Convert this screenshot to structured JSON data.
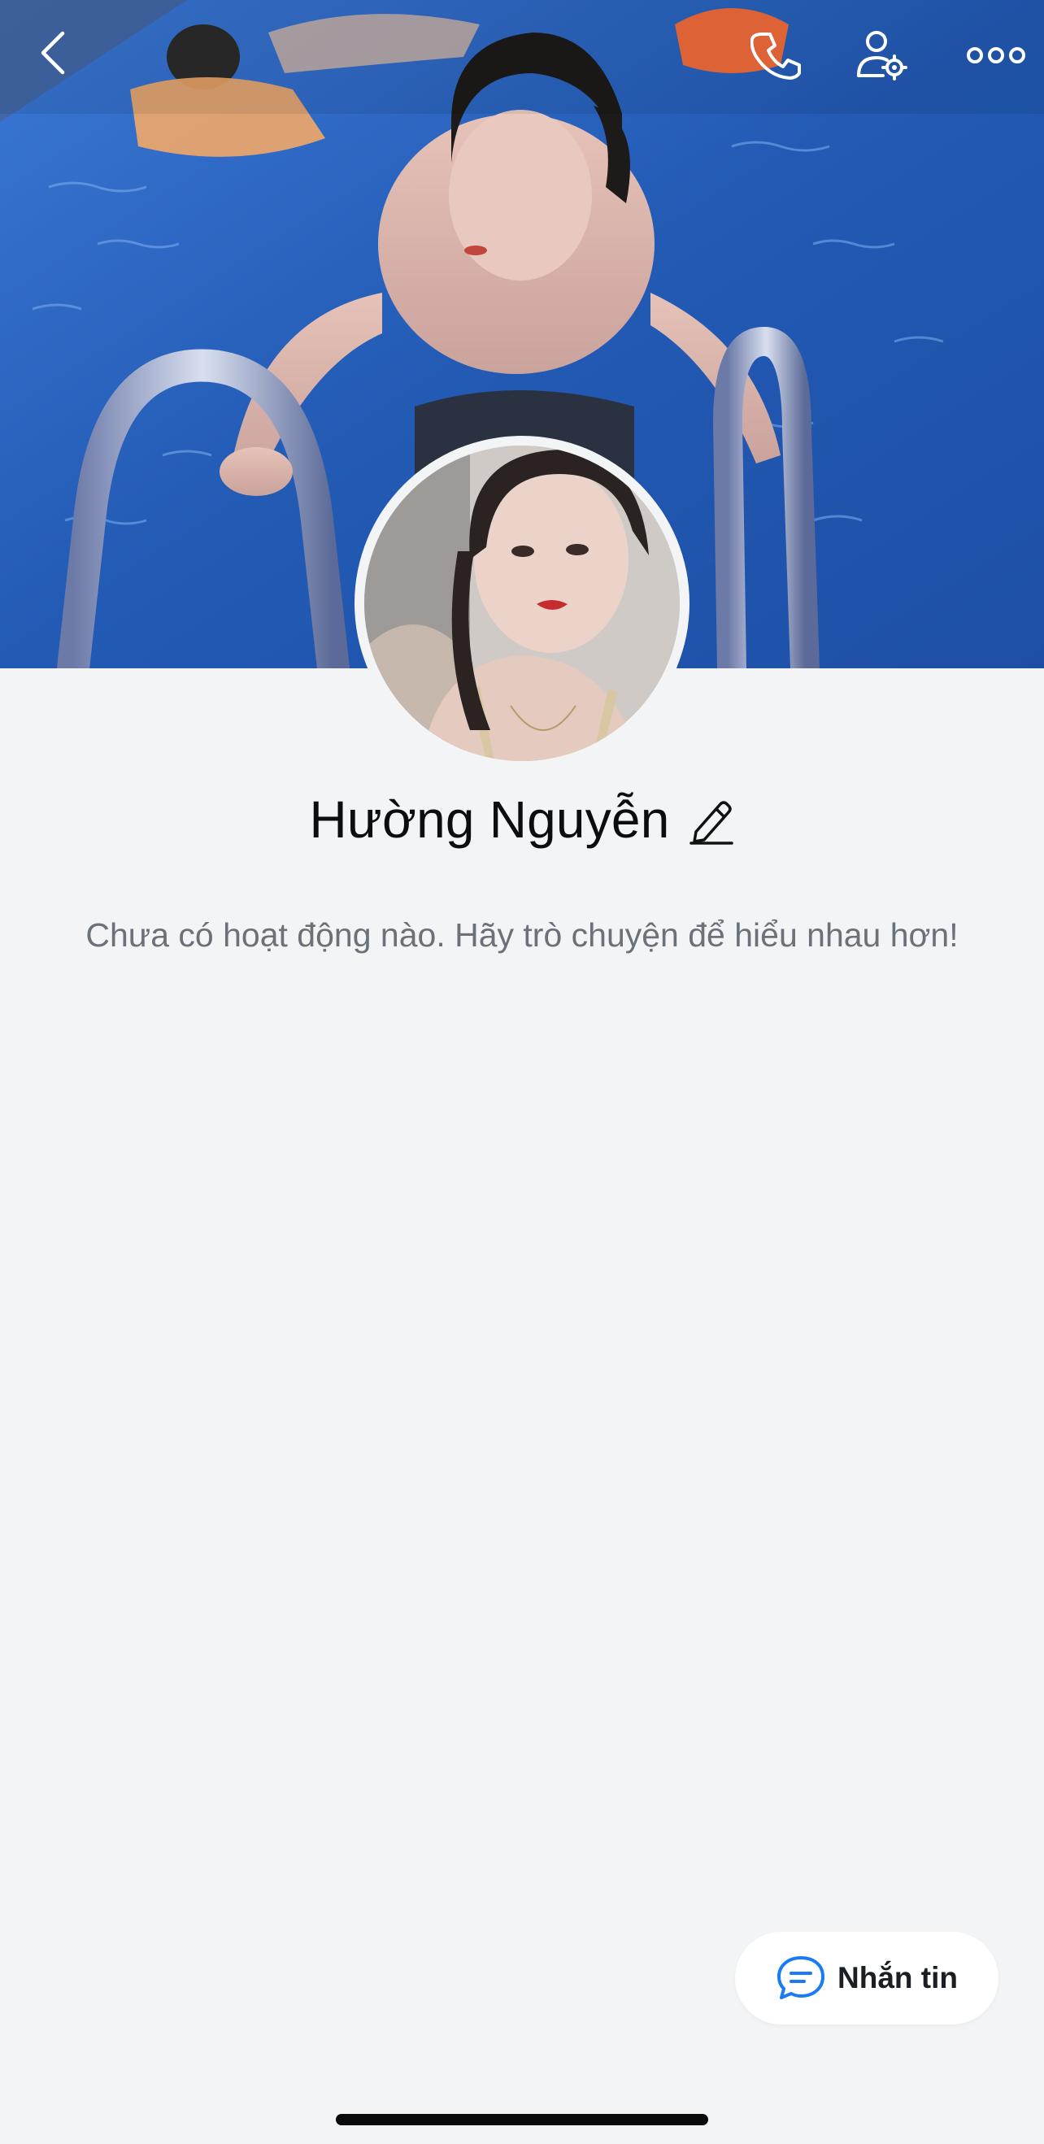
{
  "profile": {
    "name": "Hường Nguyễn",
    "empty_activity_text": "Chưa có hoạt động nào. Hãy trò chuyện để hiểu nhau hơn!"
  },
  "topbar": {
    "icons": [
      "back-icon",
      "phone-icon",
      "user-settings-icon",
      "more-icon"
    ]
  },
  "actions": {
    "message_label": "Nhắn tin"
  },
  "colors": {
    "background": "#f3f4f6",
    "accent": "#1a7bf2",
    "text_primary": "#0b0d10",
    "text_secondary": "#6b7178"
  }
}
